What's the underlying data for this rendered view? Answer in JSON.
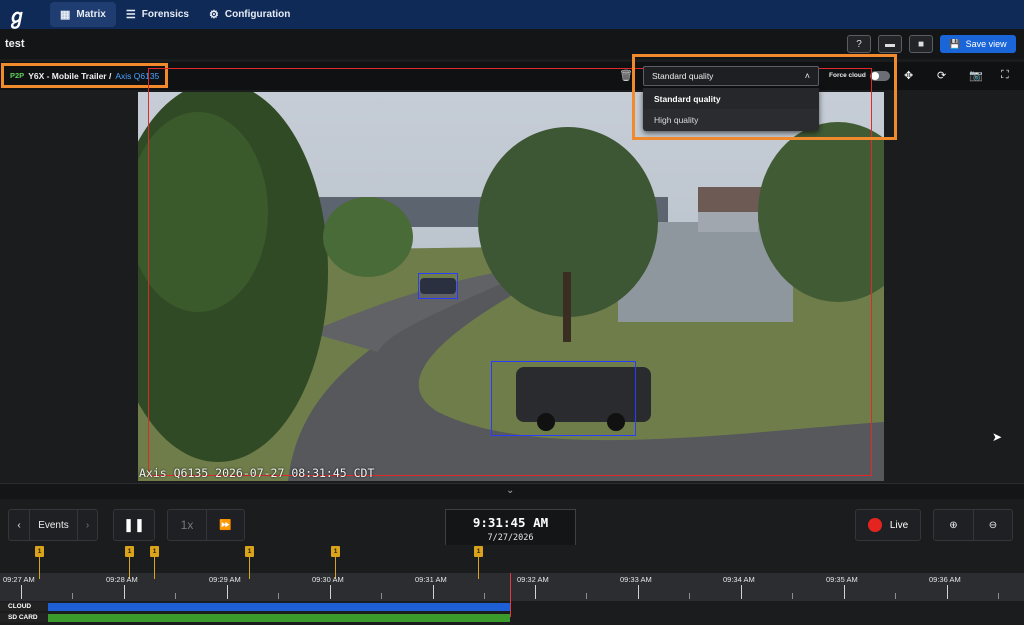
{
  "nav": {
    "logo": "ℊ",
    "tabs": [
      {
        "label": "Matrix",
        "icon": "grid-icon",
        "active": true
      },
      {
        "label": "Forensics",
        "icon": "search-list-icon",
        "active": false
      },
      {
        "label": "Configuration",
        "icon": "gear-icon",
        "active": false
      }
    ]
  },
  "view": {
    "title": "test",
    "save_label": "Save view"
  },
  "camera": {
    "badge": "P2P",
    "site": "Y6X - Mobile Trailer /",
    "name": "Axis Q6135",
    "force_cloud_label": "Force cloud",
    "force_cloud_on": false,
    "osd_text": "Axis Q6135 2026-07-27 08:31:45 CDT"
  },
  "quality": {
    "selected": "Standard quality",
    "options": [
      "Standard quality",
      "High quality"
    ]
  },
  "playback": {
    "events_label": "Events",
    "speed_label": "1x",
    "time": "9:31:45 AM",
    "date": "7/27/2026",
    "live_label": "Live"
  },
  "timeline": {
    "labels": [
      "09:27 AM",
      "09:28 AM",
      "09:29 AM",
      "09:30 AM",
      "09:31 AM",
      "09:32 AM",
      "09:33 AM",
      "09:34 AM",
      "09:35 AM",
      "09:36 AM"
    ],
    "markers": [
      "1",
      "1",
      "1",
      "1",
      "1",
      "1"
    ],
    "tracks": [
      {
        "label": "CLOUD",
        "color": "#1f5fd6"
      },
      {
        "label": "SD CARD",
        "color": "#3a9a2c"
      }
    ]
  },
  "colors": {
    "accent": "#1a66d9",
    "highlight": "#f08a2c",
    "live": "#e52420",
    "marker": "#d9a41c"
  }
}
